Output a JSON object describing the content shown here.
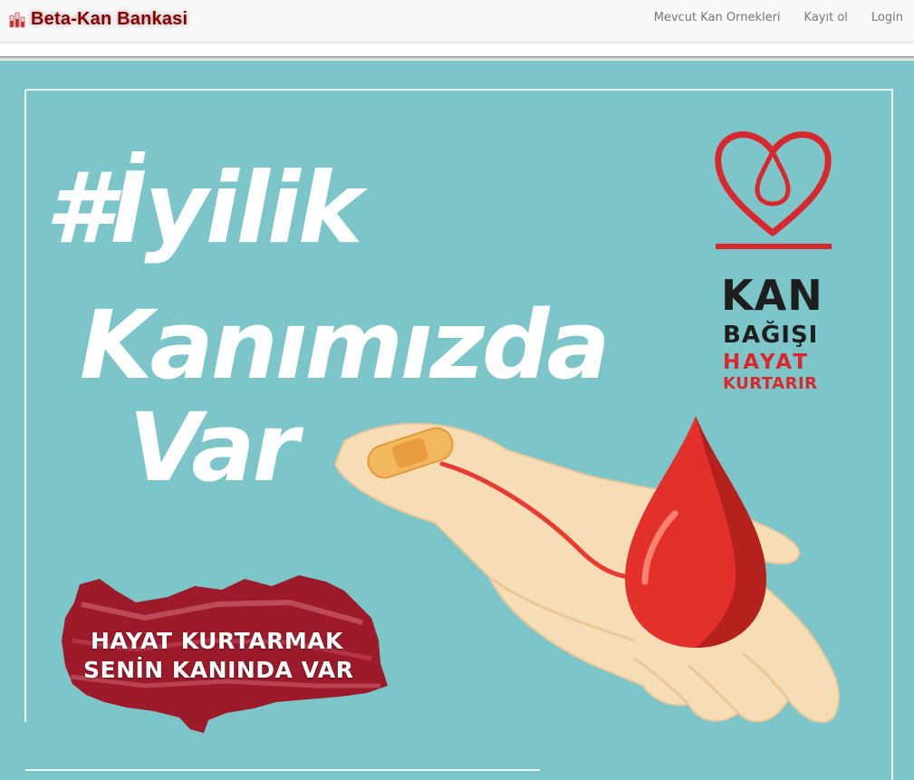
{
  "navbar": {
    "brand": "Beta-Kan Bankasi",
    "links": [
      "Mevcut Kan Ornekleri",
      "Kayıt ol",
      "Login"
    ]
  },
  "hero": {
    "headline": [
      "#İyilik",
      "Kanımızda",
      "Var"
    ],
    "campaign": [
      "KAN",
      "BAĞIŞI",
      "HAYAT",
      "KURTARIR"
    ],
    "slogan": [
      "HAYAT KURTARMAK",
      "SENİN KANINDA VAR"
    ]
  },
  "colors": {
    "brand": "#8b0000",
    "banner_background": "#7cc6ca",
    "accent_red": "#d9282d"
  },
  "icons": [
    "blood-bags-icon",
    "heart-drop-icon",
    "blood-drop-icon"
  ]
}
